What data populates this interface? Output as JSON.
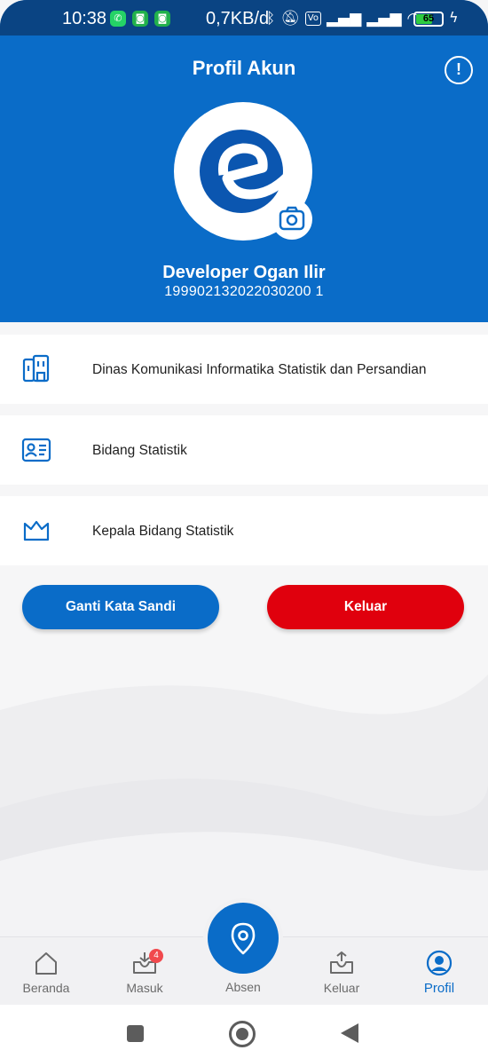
{
  "status_bar": {
    "time": "10:38",
    "network_speed": "0,7KB/d",
    "battery_level": "65",
    "battery_percent": 65,
    "app_icons": [
      "whatsapp-icon",
      "android-app-icon",
      "android-app-icon"
    ],
    "status_icons": [
      "bluetooth-icon",
      "mute-icon",
      "volte-icon",
      "signal-icon",
      "signal-icon",
      "wifi-icon",
      "battery-icon",
      "charging-icon"
    ]
  },
  "header": {
    "title": "Profil Akun",
    "info_icon": "info-icon",
    "camera_icon": "camera-icon"
  },
  "profile": {
    "name": "Developer Ogan Ilir",
    "nip": "199902132022030200 1"
  },
  "details": [
    {
      "icon": "building-icon",
      "text": "Dinas Komunikasi Informatika Statistik dan Persandian"
    },
    {
      "icon": "id-card-icon",
      "text": "Bidang Statistik"
    },
    {
      "icon": "crown-icon",
      "text": "Kepala Bidang Statistik"
    }
  ],
  "actions": {
    "change_password": "Ganti Kata Sandi",
    "logout": "Keluar"
  },
  "bottom_nav": {
    "items": [
      {
        "label": "Beranda",
        "icon": "home-icon"
      },
      {
        "label": "Masuk",
        "icon": "inbox-icon",
        "badge": "4"
      },
      {
        "label": "Absen",
        "icon": "location-pin-icon"
      },
      {
        "label": "Keluar",
        "icon": "outbox-icon"
      },
      {
        "label": "Profil",
        "icon": "profile-icon"
      }
    ],
    "active": "Profil"
  },
  "colors": {
    "primary": "#0a6cc8",
    "danger": "#e0000d",
    "badge": "#f1494d"
  }
}
